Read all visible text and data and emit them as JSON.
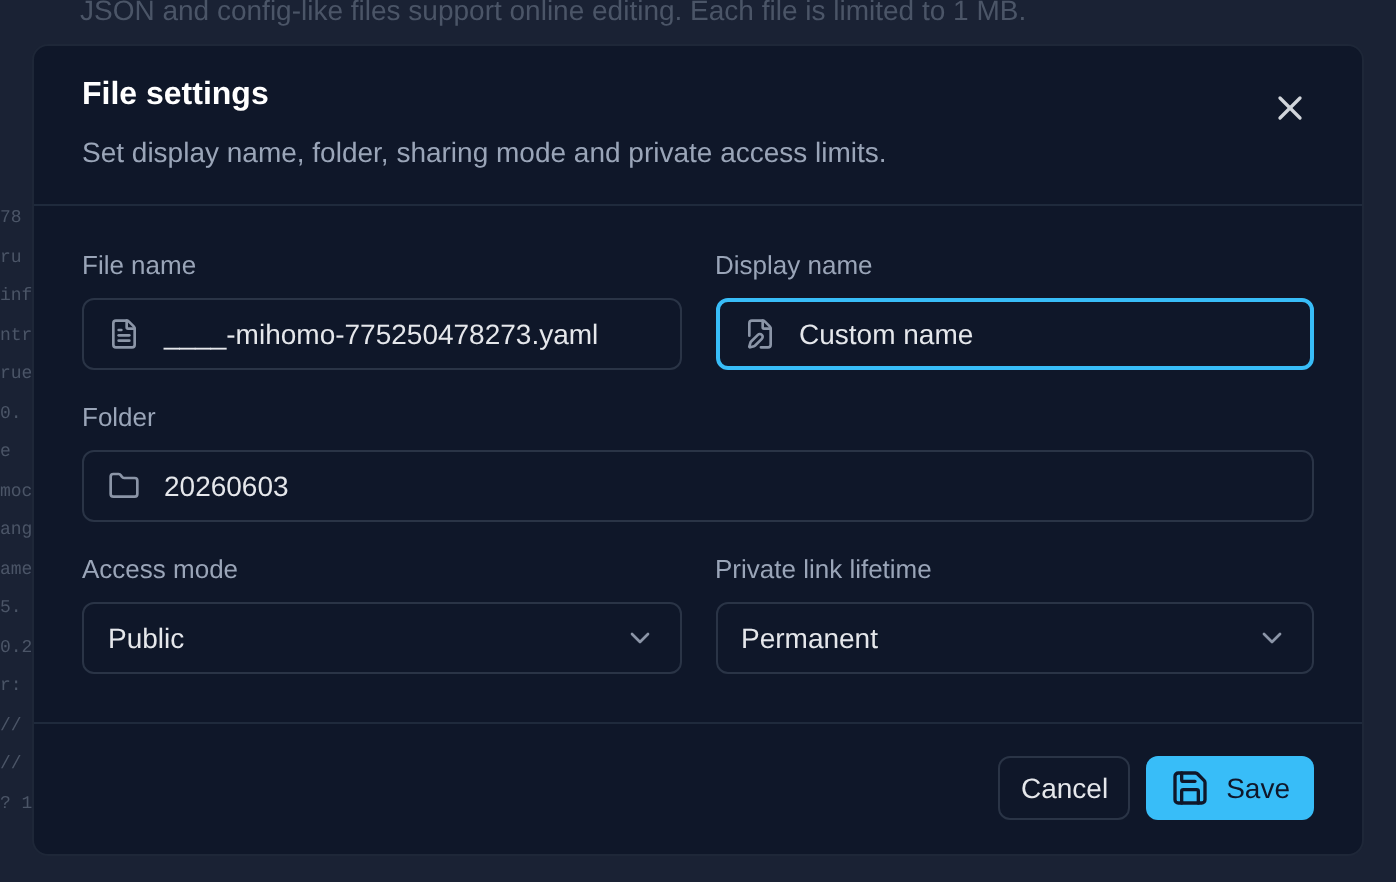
{
  "background": {
    "notice": "JSON and config-like files support online editing. Each file is limited to 1 MB.",
    "code_fragments": [
      "78",
      "ru",
      "inf",
      "ntr",
      "rue",
      "0.",
      "e",
      "moc",
      "ang",
      "ame",
      "5.",
      "0.2",
      "r:",
      "//",
      "//",
      "? 1"
    ]
  },
  "dialog": {
    "title": "File settings",
    "subtitle": "Set display name, folder, sharing mode and private access limits.",
    "fields": [
      {
        "kind": "text",
        "label": "File name",
        "value": "____-mihomo-775250478273.yaml",
        "focused": false
      },
      {
        "kind": "text",
        "label": "Display name",
        "value": "Custom name",
        "focused": true
      },
      {
        "kind": "text",
        "label": "Folder",
        "value": "20260603",
        "focused": false
      },
      {
        "kind": "select",
        "label": "Access mode",
        "value": "Public",
        "focused": false
      },
      {
        "kind": "select",
        "label": "Private link lifetime",
        "value": "Permanent",
        "focused": false
      }
    ],
    "buttons": [
      {
        "label": "Cancel",
        "kind": "secondary"
      },
      {
        "label": "Save",
        "kind": "primary"
      }
    ]
  }
}
